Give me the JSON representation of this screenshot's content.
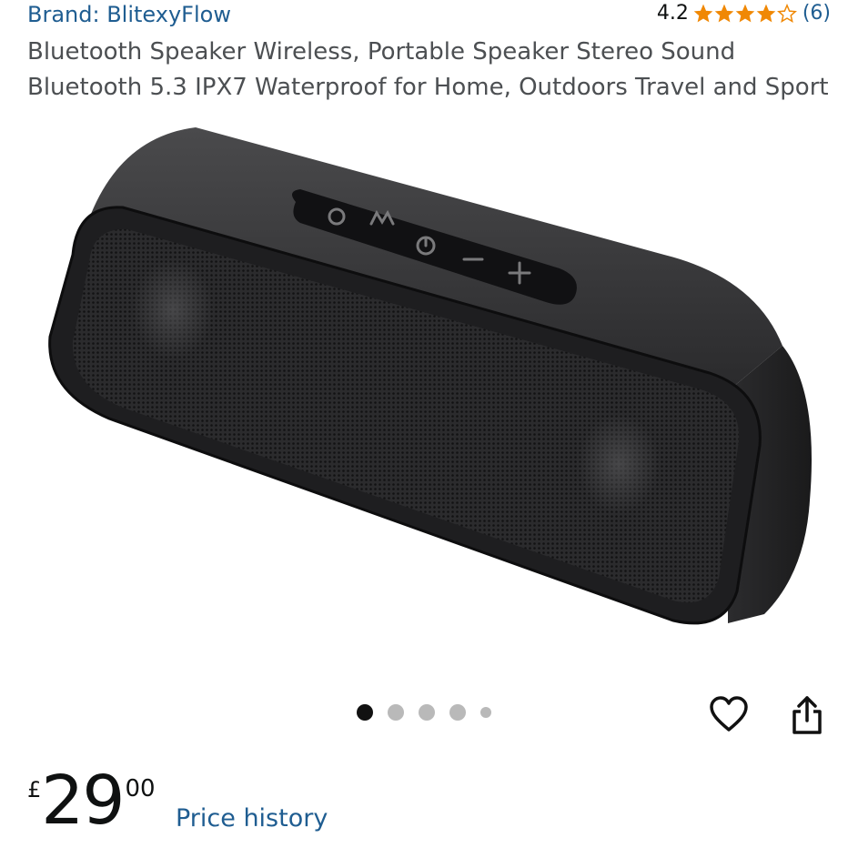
{
  "header": {
    "brand_label": "Brand: BlitexyFlow",
    "rating_value": "4.2",
    "rating_stars": 4.2,
    "rating_count": "(6)",
    "star_color": "#f08804"
  },
  "product": {
    "title": "Bluetooth Speaker Wireless, Portable Speaker Stereo Sound Bluetooth 5.3 IPX7 Waterproof for Home, Outdoors Travel and Sport",
    "image_name": "bluetooth-speaker-photo",
    "carousel": {
      "total_dots": 5,
      "active_index": 0
    }
  },
  "actions": {
    "wishlist_icon": "heart-outline-icon",
    "share_icon": "share-icon"
  },
  "pricing": {
    "currency_symbol": "£",
    "whole": "29",
    "fraction": "00",
    "history_link": "Price history"
  },
  "colors": {
    "link": "#1f5d91",
    "star": "#f08804",
    "text_muted": "#4c4f52"
  }
}
